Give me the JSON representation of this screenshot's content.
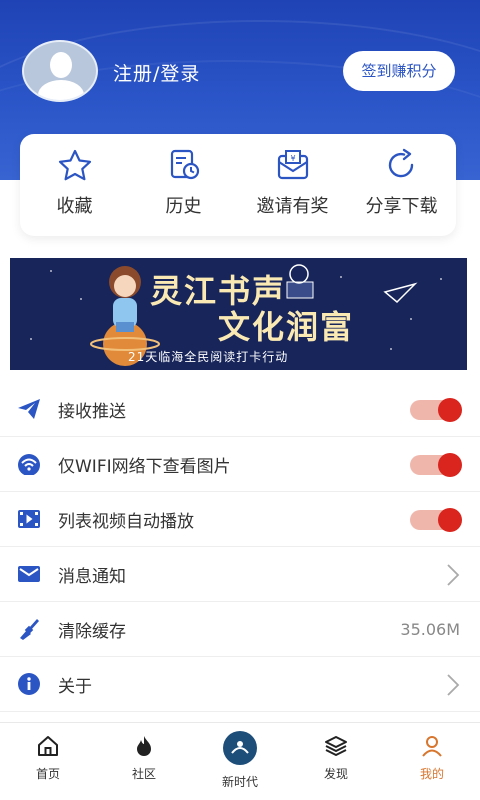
{
  "header": {
    "login_text": "注册/登录",
    "signin_button": "签到赚积分"
  },
  "quick_actions": [
    {
      "label": "收藏",
      "icon": "star-icon"
    },
    {
      "label": "历史",
      "icon": "history-icon"
    },
    {
      "label": "邀请有奖",
      "icon": "invite-envelope-icon"
    },
    {
      "label": "分享下载",
      "icon": "share-icon"
    }
  ],
  "banner": {
    "title_line1": "灵江书声",
    "title_line2": "文化润富",
    "subtitle": "21天临海全民阅读打卡行动"
  },
  "settings": [
    {
      "label": "接收推送",
      "icon": "paper-plane-icon",
      "control": "toggle",
      "on": true
    },
    {
      "label": "仅WIFI网络下查看图片",
      "icon": "wifi-icon",
      "control": "toggle",
      "on": true
    },
    {
      "label": "列表视频自动播放",
      "icon": "video-play-icon",
      "control": "toggle",
      "on": true
    },
    {
      "label": "消息通知",
      "icon": "mail-icon",
      "control": "chevron"
    },
    {
      "label": "清除缓存",
      "icon": "broom-icon",
      "control": "value",
      "value": "35.06M"
    },
    {
      "label": "关于",
      "icon": "info-icon",
      "control": "chevron"
    }
  ],
  "tabbar": [
    {
      "label": "首页",
      "icon": "home-icon",
      "active": false
    },
    {
      "label": "社区",
      "icon": "community-flame-icon",
      "active": false
    },
    {
      "label": "新时代",
      "icon": "new-era-logo-icon",
      "active": false
    },
    {
      "label": "发现",
      "icon": "discover-layers-icon",
      "active": false
    },
    {
      "label": "我的",
      "icon": "profile-icon",
      "active": true
    }
  ],
  "colors": {
    "header_blue": "#2a55c8",
    "accent_blue": "#2c55c4",
    "toggle_red": "#d9251d",
    "active_tab": "#d8762e"
  }
}
